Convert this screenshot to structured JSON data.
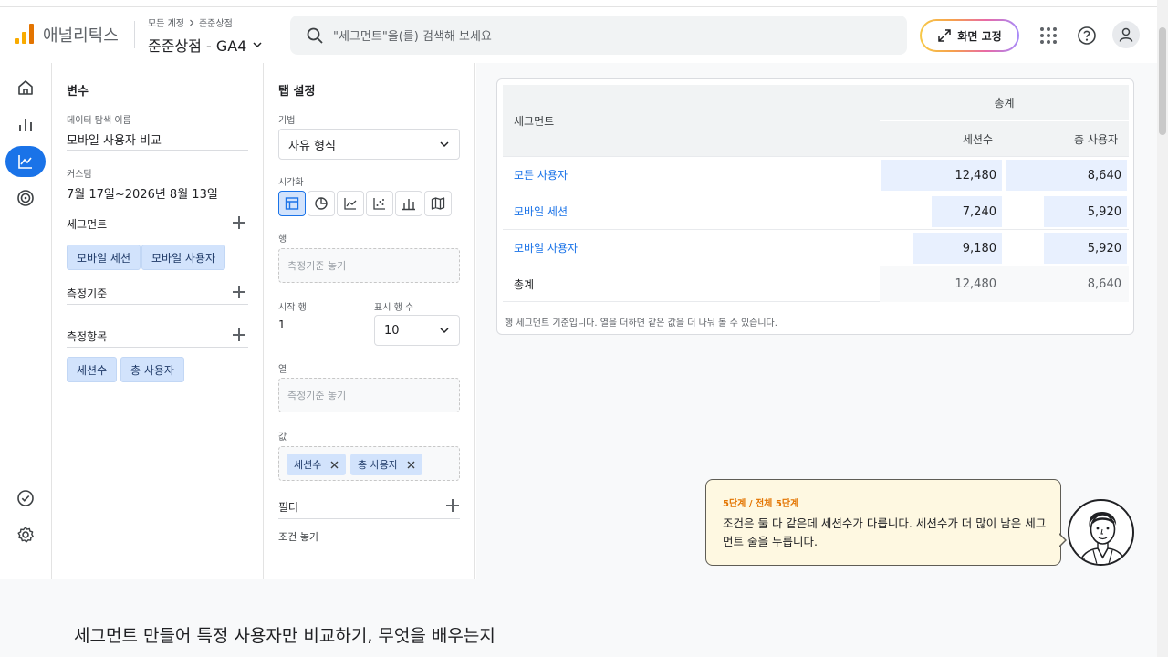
{
  "app": {
    "brand": "애널리틱스",
    "account_path": [
      "모든 계정",
      "준준상점"
    ],
    "property": "준준상점 - GA4"
  },
  "search": {
    "placeholder": "\"세그먼트\"을(를) 검색해 보세요"
  },
  "header": {
    "pin_label": "화면 고정",
    "icons": [
      "apps-icon",
      "help-icon",
      "account-icon"
    ]
  },
  "leftnav": {
    "items": [
      "home-icon",
      "reports-icon",
      "explore-icon",
      "advertising-icon"
    ],
    "bottom": [
      "checklist-icon",
      "settings-icon"
    ]
  },
  "variables": {
    "title": "변수",
    "name_label": "데이터 탐색 이름",
    "name_value": "모바일 사용자 비교",
    "date_label": "커스텀",
    "date_value": "7월 17일~2026년 8월 13일",
    "segments_label": "세그먼트",
    "segments": [
      "모바일 세션",
      "모바일 사용자"
    ],
    "dimensions_label": "측정기준",
    "metrics_label": "측정항목",
    "metrics": [
      "세션수",
      "총 사용자"
    ]
  },
  "tab_settings": {
    "title": "탭 설정",
    "technique_label": "기법",
    "technique_value": "자유 형식",
    "viz_label": "시각화",
    "rows_label": "행",
    "rows_placeholder": "측정기준 놓기",
    "start_row_label": "시작 행",
    "start_row_value": "1",
    "show_rows_label": "표시 행 수",
    "show_rows_value": "10",
    "columns_label": "열",
    "columns_placeholder": "측정기준 놓기",
    "values_label": "값",
    "values": [
      "세션수",
      "총 사용자"
    ],
    "filters_label": "필터",
    "filters_placeholder": "조건 놓기"
  },
  "table": {
    "seg_header": "세그먼트",
    "group_header": "총계",
    "columns": [
      "세션수",
      "총 사용자"
    ],
    "rows": [
      {
        "segment": "모든 사용자",
        "sessions": "12,480",
        "users": "8,640"
      },
      {
        "segment": "모바일 세션",
        "sessions": "7,240",
        "users": "5,920"
      },
      {
        "segment": "모바일 사용자",
        "sessions": "9,180",
        "users": "5,920"
      }
    ],
    "total": {
      "segment": "총계",
      "sessions": "12,480",
      "users": "8,640"
    },
    "bar_fractions": {
      "sessions": [
        1.0,
        0.58,
        0.736
      ],
      "users": [
        1.0,
        0.685,
        0.685
      ]
    },
    "note": "행 세그먼트 기준입니다. 열을 더하면 같은 값을 더 나눠 볼 수 있습니다."
  },
  "tutorial": {
    "step": "5단계 / 전체 5단계",
    "message": "조건은 둘 다 같은데 세션수가 다릅니다. 세션수가 더 많이 남은 세그먼트 줄을 누릅니다."
  },
  "footer": {
    "title": "세그먼트 만들어 특정 사용자만 비교하기, 무엇을 배우는지"
  },
  "colors": {
    "accent": "#1a73e8",
    "chip": "#d2e3fc",
    "tutorial_step": "#e37400",
    "bubble": "#fef8e1"
  }
}
